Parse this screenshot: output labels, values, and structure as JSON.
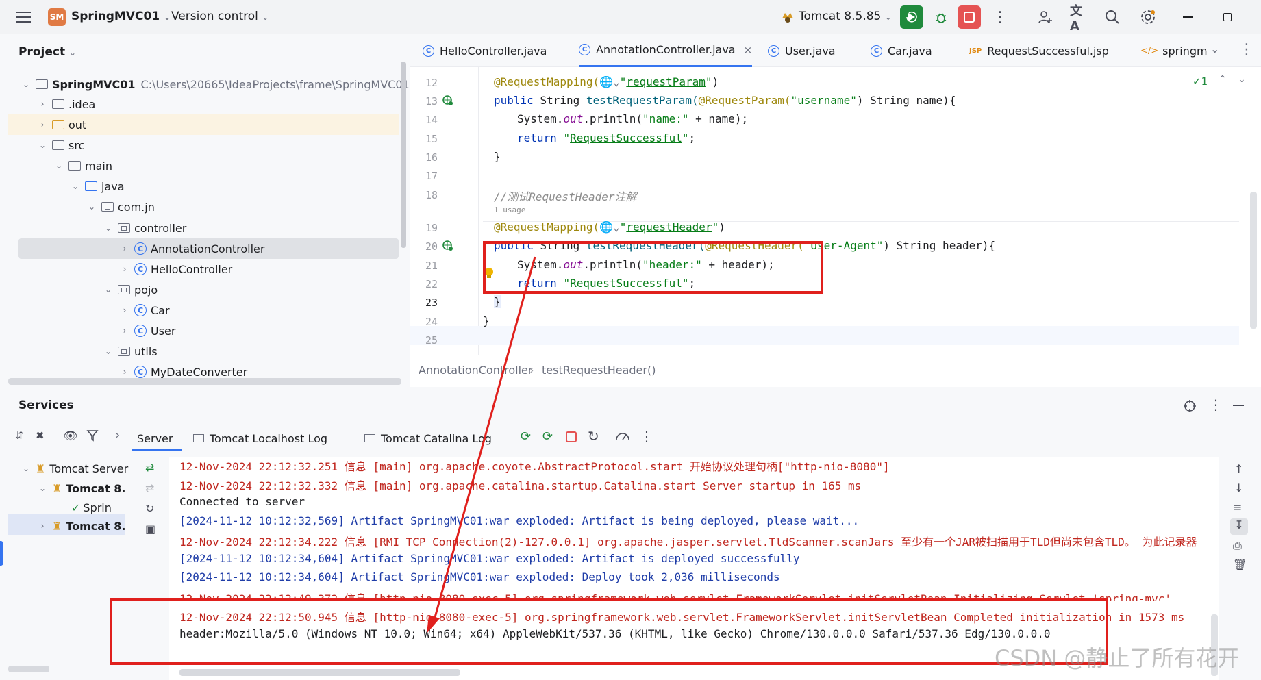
{
  "titlebar": {
    "project_badge": "SM",
    "project_name": "SpringMVC01",
    "vcs": "Version control",
    "run_config": "Tomcat 8.5.85"
  },
  "project_panel": {
    "title": "Project",
    "tree": [
      {
        "label": "SpringMVC01",
        "extra": "C:\\Users\\20665\\IdeaProjects\\frame\\SpringMVC01"
      },
      {
        "label": ".idea"
      },
      {
        "label": "out"
      },
      {
        "label": "src"
      },
      {
        "label": "main"
      },
      {
        "label": "java"
      },
      {
        "label": "com.jn"
      },
      {
        "label": "controller"
      },
      {
        "label": "AnnotationController"
      },
      {
        "label": "HelloController"
      },
      {
        "label": "pojo"
      },
      {
        "label": "Car"
      },
      {
        "label": "User"
      },
      {
        "label": "utils"
      },
      {
        "label": "MyDateConverter"
      }
    ]
  },
  "editor": {
    "tabs": [
      {
        "label": "HelloController.java"
      },
      {
        "label": "AnnotationController.java",
        "active": true
      },
      {
        "label": "User.java"
      },
      {
        "label": "Car.java"
      },
      {
        "label": "RequestSuccessful.jsp"
      },
      {
        "label": "springm"
      }
    ],
    "inspection_count": "1",
    "line_numbers": [
      "12",
      "13",
      "14",
      "15",
      "16",
      "17",
      "18",
      "19",
      "20",
      "21",
      "22",
      "23",
      "24",
      "25"
    ],
    "breadcrumb": [
      "AnnotationController",
      "testRequestHeader()"
    ],
    "code": {
      "l12_ann": "@RequestMapping(",
      "l12_str": "requestParam",
      "l13_a": "public ",
      "l13_b": "String ",
      "l13_c": "testRequestParam(",
      "l13_ann": "@RequestParam(",
      "l13_str": "username",
      "l13_d": ") String name){",
      "l14_a": "System.",
      "l14_out": "out",
      "l14_b": ".println(",
      "l14_str": "\"name:\"",
      "l14_c": " + name);",
      "l15_kw": "return ",
      "l15_str": "RequestSuccessful",
      "l16": "}",
      "l18_cmt": "//测试RequestHeader注解",
      "l18_hint": "1 usage",
      "l19_ann": "@RequestMapping(",
      "l19_str": "requestHeader",
      "l20_a": "public ",
      "l20_b": "String ",
      "l20_c": "testRequestHeader(",
      "l20_ann": "@RequestHeader(",
      "l20_str": "\"User-Agent\"",
      "l20_d": ") String header){",
      "l21_a": "System.",
      "l21_out": "out",
      "l21_b": ".println(",
      "l21_str": "\"header:\"",
      "l21_c": " + header);",
      "l22_kw": "return ",
      "l22_str": "RequestSuccessful",
      "l23": "}",
      "l24": "}"
    }
  },
  "services": {
    "title": "Services",
    "tabs": [
      {
        "label": "Server",
        "active": true
      },
      {
        "label": "Tomcat Localhost Log"
      },
      {
        "label": "Tomcat Catalina Log"
      }
    ],
    "tree": [
      {
        "label": "Tomcat Server"
      },
      {
        "label": "Tomcat 8."
      },
      {
        "label": "Sprin"
      },
      {
        "label": "Tomcat 8."
      }
    ],
    "log_lines": [
      {
        "text": "12-Nov-2024 22:12:32.251 信息 [main] org.apache.coyote.AbstractProtocol.start 开始协议处理句柄[\"http-nio-8080\"]",
        "tone": "red"
      },
      {
        "text": "12-Nov-2024 22:12:32.332 信息 [main] org.apache.catalina.startup.Catalina.start Server startup in 165 ms",
        "tone": "red"
      },
      {
        "text": "Connected to server",
        "tone": "dark"
      },
      {
        "text": "[2024-11-12 10:12:32,569] Artifact SpringMVC01:war exploded: Artifact is being deployed, please wait...",
        "tone": "blue"
      },
      {
        "text": "12-Nov-2024 22:12:34.222 信息 [RMI TCP Connection(2)-127.0.0.1] org.apache.jasper.servlet.TldScanner.scanJars 至少有一个JAR被扫描用于TLD但尚未包含TLD。 为此记录器",
        "tone": "red"
      },
      {
        "text": "[2024-11-12 10:12:34,604] Artifact SpringMVC01:war exploded: Artifact is deployed successfully",
        "tone": "blue"
      },
      {
        "text": "[2024-11-12 10:12:34,604] Artifact SpringMVC01:war exploded: Deploy took 2,036 milliseconds",
        "tone": "blue"
      },
      {
        "text": "12-Nov-2024 22:12:49.372 信息 [http-nio-8080-exec-5] org.springframework.web.servlet.FrameworkServlet.initServletBean Initializing Servlet 'spring-mvc'",
        "tone": "red"
      },
      {
        "text": "12-Nov-2024 22:12:50.945 信息 [http-nio-8080-exec-5] org.springframework.web.servlet.FrameworkServlet.initServletBean Completed initialization in 1573 ms",
        "tone": "red"
      },
      {
        "text": "header:Mozilla/5.0 (Windows NT 10.0; Win64; x64) AppleWebKit/537.36 (KHTML, like Gecko) Chrome/130.0.0.0 Safari/537.36 Edg/130.0.0.0",
        "tone": "dark"
      }
    ]
  },
  "watermark": "CSDN @静止了所有花开",
  "colors": {
    "accent": "#3574f0",
    "annotation_box": "#e0201d",
    "run_green": "#208a3c",
    "stop_red": "#e55353"
  }
}
